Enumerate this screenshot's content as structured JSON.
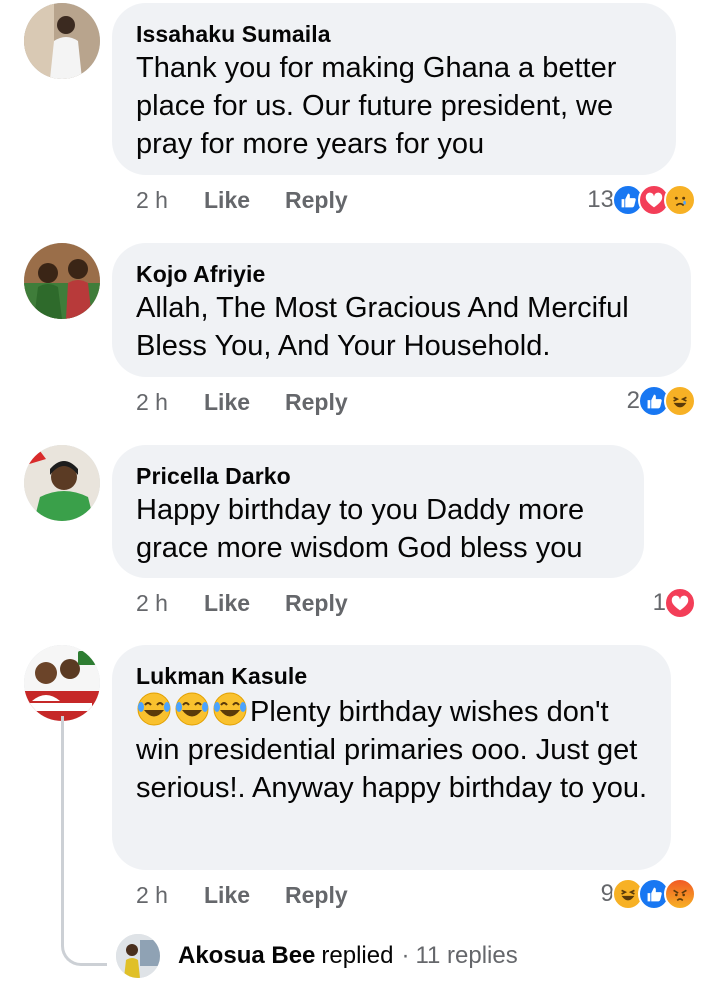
{
  "comments": [
    {
      "author": "Issahaku Sumaila",
      "text": "Thank you for making Ghana a better place for us. Our future president, we pray for more years for you",
      "time": "2 h",
      "like_label": "Like",
      "reply_label": "Reply",
      "reaction_count": "13",
      "reactions": [
        "like-icon",
        "love-icon",
        "sad-icon"
      ]
    },
    {
      "author": "Kojo Afriyie",
      "text": "Allah, The Most Gracious And Merciful Bless You, And Your Household.",
      "time": "2 h",
      "like_label": "Like",
      "reply_label": "Reply",
      "reaction_count": "2",
      "reactions": [
        "like-icon",
        "haha-icon"
      ]
    },
    {
      "author": "Pricella Darko",
      "text": "Happy birthday to you Daddy more grace more wisdom God bless you",
      "time": "2 h",
      "like_label": "Like",
      "reply_label": "Reply",
      "reaction_count": "1",
      "reactions": [
        "love-icon"
      ]
    },
    {
      "author": "Lukman Kasule",
      "text": "Plenty birthday wishes don't win presidential primaries ooo. Just get serious!. Anyway happy birthday to you.",
      "text_emojis": [
        "laughing-tears-emoji",
        "laughing-tears-emoji",
        "laughing-tears-emoji"
      ],
      "time": "2 h",
      "like_label": "Like",
      "reply_label": "Reply",
      "reaction_count": "9",
      "reactions": [
        "haha-icon",
        "like-icon",
        "angry-icon"
      ]
    }
  ],
  "thread_reply": {
    "name": "Akosua Bee",
    "verb": "replied",
    "separator": "·",
    "count": "11 replies"
  },
  "colors": {
    "bubble": "#f0f2f5",
    "meta_text": "#65676b",
    "like_blue": "#1877f2",
    "love_red": "#f33e58",
    "haha_yellow": "#f7b125"
  }
}
